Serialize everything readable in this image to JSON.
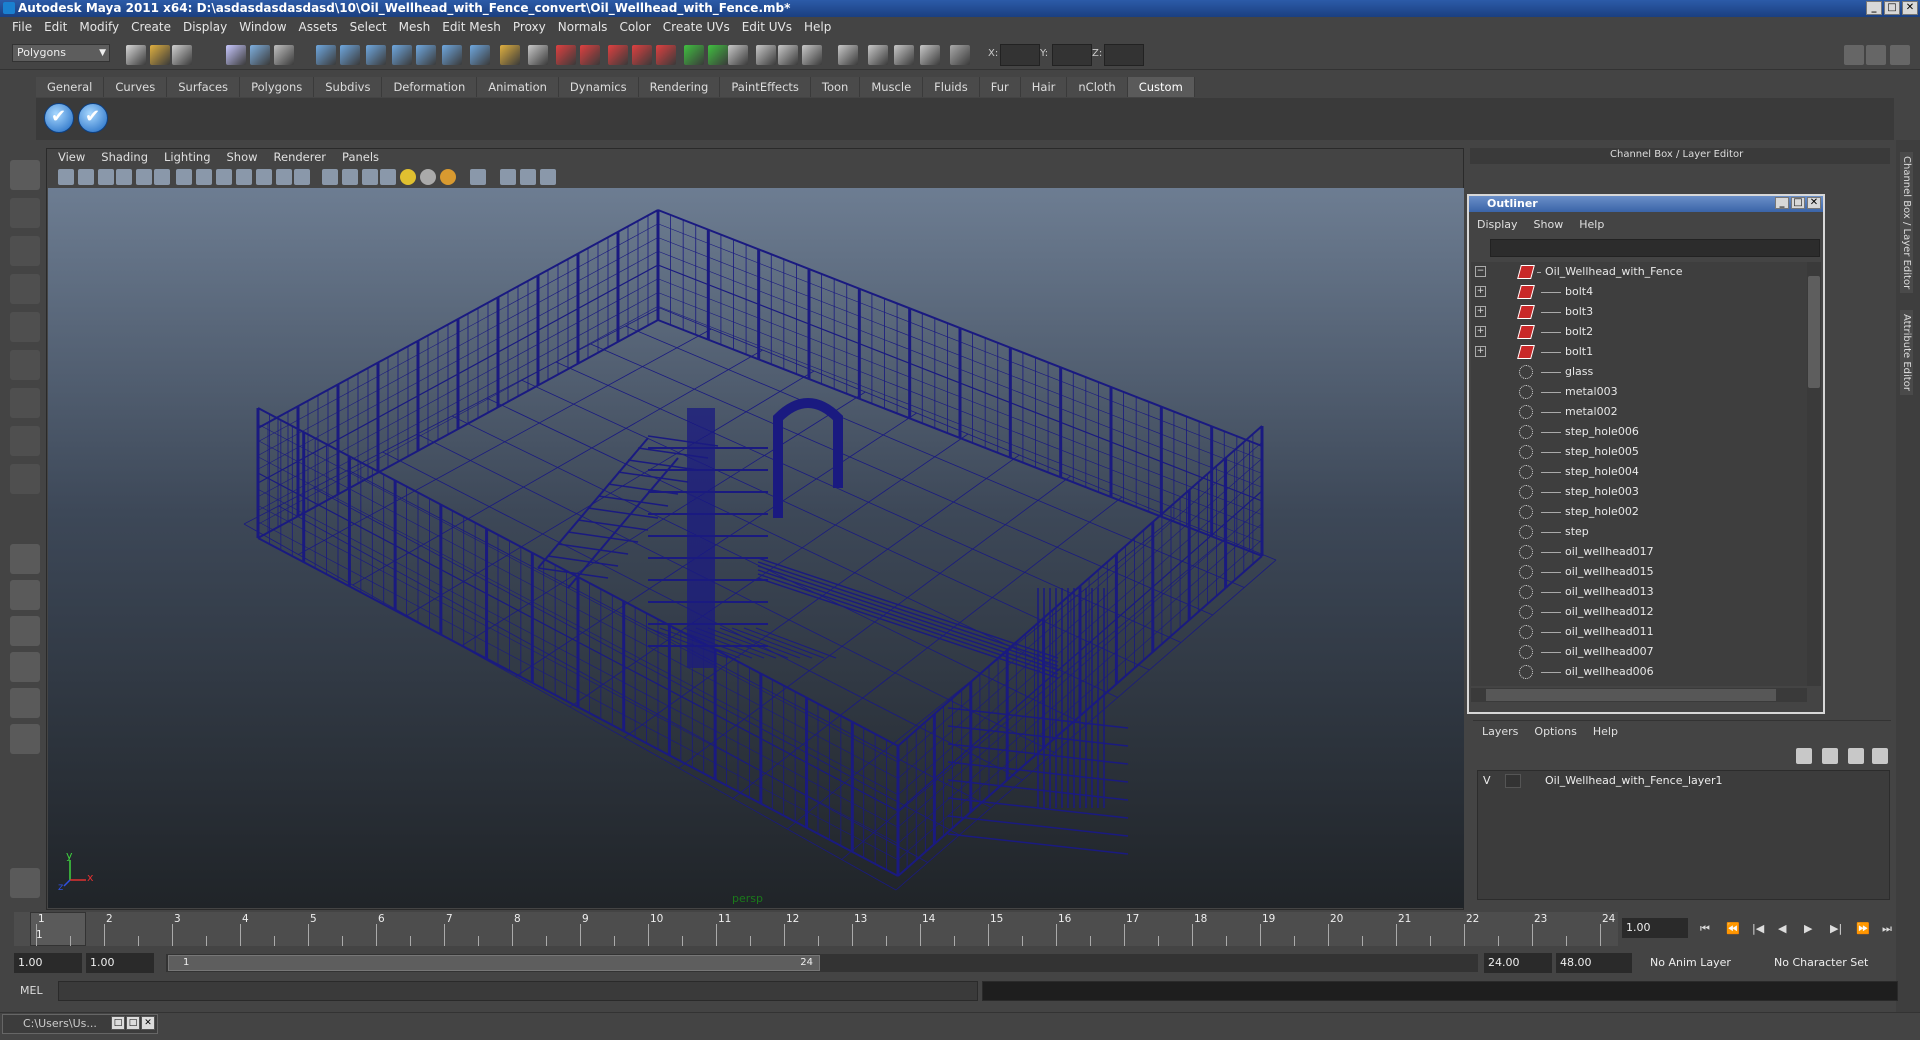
{
  "window": {
    "title": "Autodesk Maya 2011 x64: D:\\asdasdasdasdasd\\10\\Oil_Wellhead_with_Fence_convert\\Oil_Wellhead_with_Fence.mb*",
    "minimize": "_",
    "maximize": "□",
    "close": "✕"
  },
  "menus": [
    "File",
    "Edit",
    "Modify",
    "Create",
    "Display",
    "Window",
    "Assets",
    "Select",
    "Mesh",
    "Edit Mesh",
    "Proxy",
    "Normals",
    "Color",
    "Create UVs",
    "Edit UVs",
    "Help"
  ],
  "status_line": {
    "mode": "Polygons",
    "x_label": "X:",
    "y_label": "Y:",
    "z_label": "Z:"
  },
  "shelf": {
    "tabs": [
      "General",
      "Curves",
      "Surfaces",
      "Polygons",
      "Subdivs",
      "Deformation",
      "Animation",
      "Dynamics",
      "Rendering",
      "PaintEffects",
      "Toon",
      "Muscle",
      "Fluids",
      "Fur",
      "Hair",
      "nCloth",
      "Custom"
    ],
    "active_tab": "Custom"
  },
  "viewport": {
    "menu": [
      "View",
      "Shading",
      "Lighting",
      "Show",
      "Renderer",
      "Panels"
    ],
    "camera_label": "persp",
    "axis_y": "y",
    "axis_x": "x",
    "axis_z": "z",
    "wire_color": "#1a1a80"
  },
  "channel_box": {
    "title": "Channel Box / Layer Editor",
    "side_tabs": [
      "Channel Box / Layer Editor",
      "Attribute Editor"
    ]
  },
  "outliner": {
    "title": "Outliner",
    "menu": [
      "Display",
      "Show",
      "Help"
    ],
    "items": [
      {
        "label": "Oil_Wellhead_with_Fence",
        "expander": "−",
        "icon": "node",
        "depth": 0
      },
      {
        "label": "bolt4",
        "expander": "+",
        "icon": "node",
        "depth": 1
      },
      {
        "label": "bolt3",
        "expander": "+",
        "icon": "node",
        "depth": 1
      },
      {
        "label": "bolt2",
        "expander": "+",
        "icon": "node",
        "depth": 1
      },
      {
        "label": "bolt1",
        "expander": "+",
        "icon": "node",
        "depth": 1
      },
      {
        "label": "glass",
        "expander": "",
        "icon": "mesh",
        "depth": 1
      },
      {
        "label": "metal003",
        "expander": "",
        "icon": "mesh",
        "depth": 1
      },
      {
        "label": "metal002",
        "expander": "",
        "icon": "mesh",
        "depth": 1
      },
      {
        "label": "step_hole006",
        "expander": "",
        "icon": "mesh",
        "depth": 1
      },
      {
        "label": "step_hole005",
        "expander": "",
        "icon": "mesh",
        "depth": 1
      },
      {
        "label": "step_hole004",
        "expander": "",
        "icon": "mesh",
        "depth": 1
      },
      {
        "label": "step_hole003",
        "expander": "",
        "icon": "mesh",
        "depth": 1
      },
      {
        "label": "step_hole002",
        "expander": "",
        "icon": "mesh",
        "depth": 1
      },
      {
        "label": "step",
        "expander": "",
        "icon": "mesh",
        "depth": 1
      },
      {
        "label": "oil_wellhead017",
        "expander": "",
        "icon": "mesh",
        "depth": 1
      },
      {
        "label": "oil_wellhead015",
        "expander": "",
        "icon": "mesh",
        "depth": 1
      },
      {
        "label": "oil_wellhead013",
        "expander": "",
        "icon": "mesh",
        "depth": 1
      },
      {
        "label": "oil_wellhead012",
        "expander": "",
        "icon": "mesh",
        "depth": 1
      },
      {
        "label": "oil_wellhead011",
        "expander": "",
        "icon": "mesh",
        "depth": 1
      },
      {
        "label": "oil_wellhead007",
        "expander": "",
        "icon": "mesh",
        "depth": 1
      },
      {
        "label": "oil_wellhead006",
        "expander": "",
        "icon": "mesh",
        "depth": 1
      }
    ]
  },
  "layers": {
    "menu": [
      "Layers",
      "Options",
      "Help"
    ],
    "layer_visibility": "V",
    "layer_name": "Oil_Wellhead_with_Fence_layer1"
  },
  "timeline": {
    "start_marker": "1",
    "ticks": [
      "1",
      "2",
      "3",
      "4",
      "5",
      "6",
      "7",
      "8",
      "9",
      "10",
      "11",
      "12",
      "13",
      "14",
      "15",
      "16",
      "17",
      "18",
      "19",
      "20",
      "21",
      "22",
      "23",
      "24"
    ],
    "current_frame": "1.00",
    "buttons": [
      "⏮",
      "⏪",
      "|◀",
      "◀",
      "▶",
      "▶|",
      "⏩",
      "⏭"
    ]
  },
  "range": {
    "start": "1.00",
    "playback_start": "1.00",
    "slider_start": "1",
    "slider_end": "24",
    "playback_end": "24.00",
    "end": "48.00",
    "anim_layer": "No Anim Layer",
    "character_set": "No Character Set"
  },
  "command_line": {
    "label": "MEL"
  },
  "taskbar": {
    "item": "C:\\Users\\Us..."
  }
}
